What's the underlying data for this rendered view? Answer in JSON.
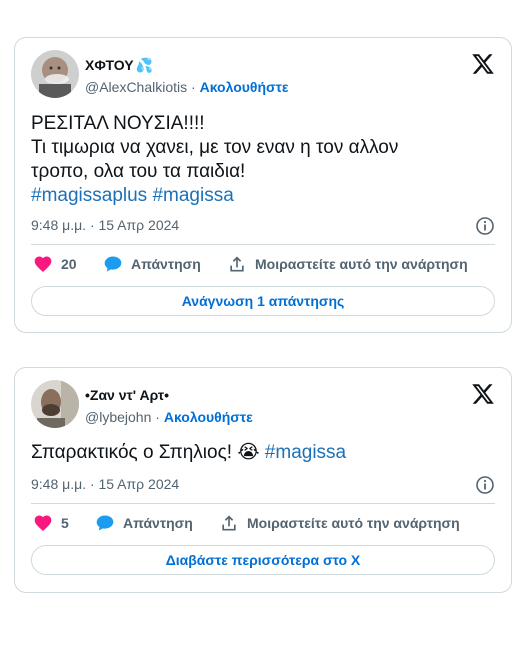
{
  "tweets": [
    {
      "author": {
        "name": "ΧΦΤΟΥ",
        "name_emoji": "💦",
        "handle": "@AlexChalkiotis",
        "separator": " · ",
        "follow": "Ακολουθήστε"
      },
      "lines": [
        "ΡΕΣΙΤΑΛ ΝΟΥΣΙΑ!!!!",
        "Τι τιμωρια να χανει, με τον εναν η τον αλλον",
        "τροπο, ολα του τα παιδια!"
      ],
      "hashtags": [
        "#magissaplus",
        "#magissa"
      ],
      "timestamp": "9:48 μ.μ. · 15 Απρ 2024",
      "likes": "20",
      "reply_label": "Απάντηση",
      "share_label": "Μοιραστείτε αυτό την ανάρτηση",
      "cta": "Ανάγνωση 1 απάντησης"
    },
    {
      "author": {
        "name": "•Ζαν ντ' Αρτ•",
        "handle": "@lybejohn",
        "separator": " · ",
        "follow": "Ακολουθήστε"
      },
      "text": "Σπαρακτικός ο Σπηλιος! ",
      "emoji": "😭",
      "hashtag": "#magissa",
      "timestamp": "9:48 μ.μ. · 15 Απρ 2024",
      "likes": "5",
      "reply_label": "Απάντηση",
      "share_label": "Μοιραστείτε αυτό την ανάρτηση",
      "cta": "Διαβάστε περισσότερα στο X"
    }
  ],
  "colors": {
    "like": "#f91880",
    "reply": "#1d9bf0",
    "link": "#006fd6",
    "muted": "#536471",
    "border": "#cfd9de"
  },
  "icons": [
    "x-logo-icon",
    "info-icon",
    "heart-icon",
    "reply-bubble-icon",
    "share-upload-icon"
  ]
}
